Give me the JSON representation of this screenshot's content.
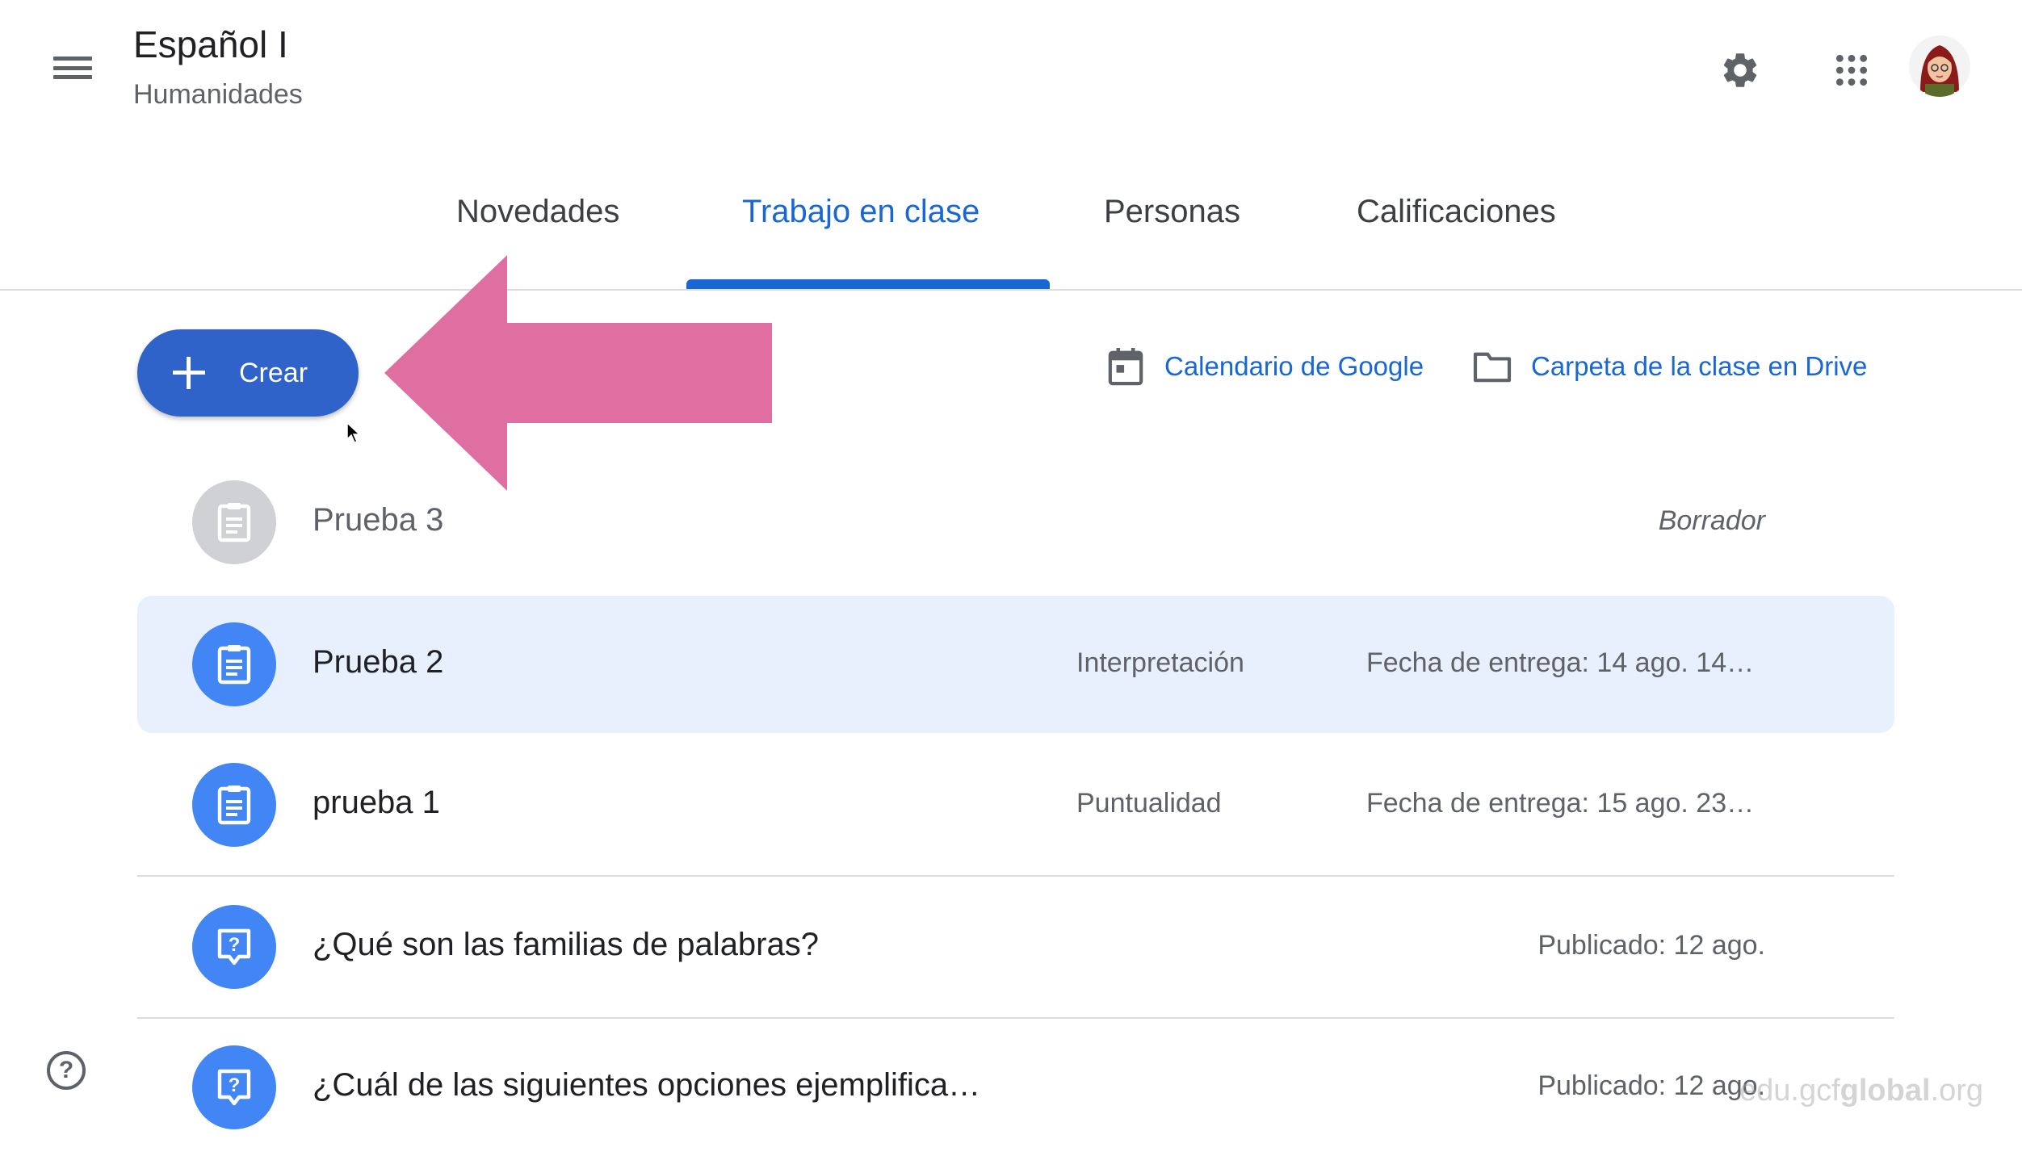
{
  "header": {
    "title": "Español I",
    "subtitle": "Humanidades",
    "menu_icon": "hamburger-menu-icon",
    "settings_icon": "gear-icon",
    "apps_icon": "apps-grid-icon",
    "avatar": "user-avatar"
  },
  "tabs": [
    {
      "label": "Novedades",
      "active": false
    },
    {
      "label": "Trabajo en clase",
      "active": true
    },
    {
      "label": "Personas",
      "active": false
    },
    {
      "label": "Calificaciones",
      "active": false
    }
  ],
  "toolbar": {
    "create_label": "Crear",
    "calendar_label": "Calendario de Google",
    "drive_label": "Carpeta de la clase en Drive"
  },
  "items": [
    {
      "title": "Prueba 3",
      "topic": "",
      "status": "Borrador",
      "icon": "assignment-icon",
      "state": "draft"
    },
    {
      "title": "Prueba 2",
      "topic": "Interpretación",
      "status": "Fecha de entrega: 14 ago. 14…",
      "icon": "assignment-icon",
      "state": "highlighted"
    },
    {
      "title": "prueba 1",
      "topic": "Puntualidad",
      "status": "Fecha de entrega: 15 ago. 23…",
      "icon": "assignment-icon",
      "state": "normal"
    },
    {
      "title": "¿Qué son las familias de palabras?",
      "topic": "",
      "status": "Publicado: 12 ago.",
      "icon": "question-icon",
      "state": "normal"
    },
    {
      "title": "¿Cuál de las siguientes opciones ejemplifica…",
      "topic": "",
      "status": "Publicado: 12 ago.",
      "icon": "question-icon",
      "state": "normal"
    }
  ],
  "watermark": {
    "prefix": "edu.gcf",
    "bold": "global",
    "suffix": ".org"
  },
  "colors": {
    "accent": "#1967d2",
    "create_button": "#2f63c9",
    "icon_blue": "#4285f4",
    "icon_gray": "#cfd1d4",
    "highlight_row": "#e8f0fe",
    "annotation_arrow": "#e06fa1"
  }
}
